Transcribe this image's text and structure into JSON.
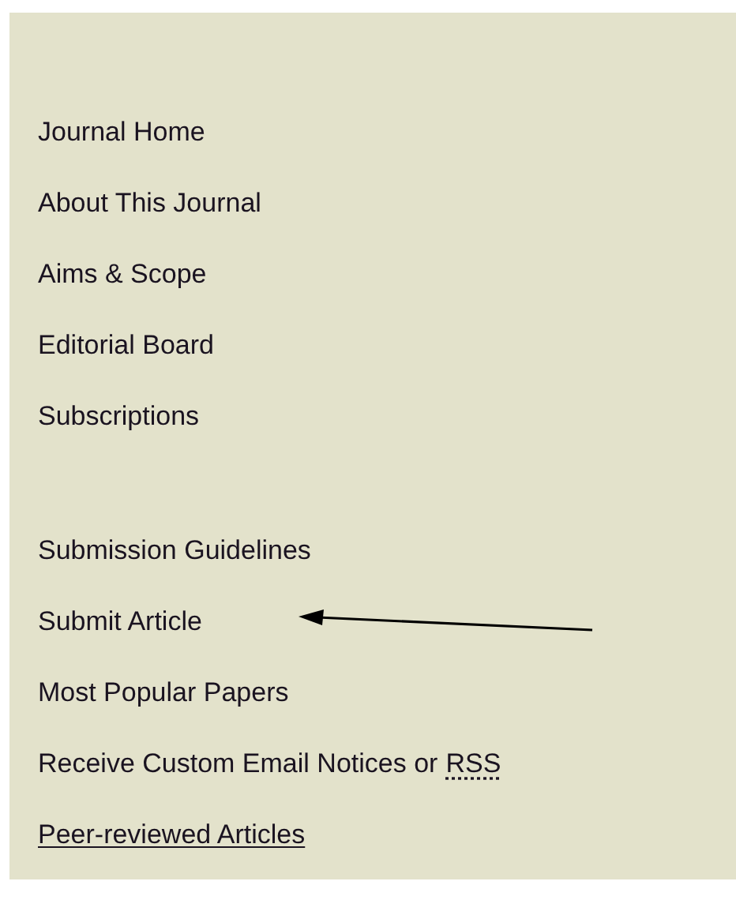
{
  "nav_groups": [
    {
      "items": [
        {
          "label": "Journal Home",
          "underlined": false,
          "arrow": false
        },
        {
          "label": "About This Journal",
          "underlined": false,
          "arrow": false
        },
        {
          "label": "Aims & Scope",
          "underlined": false,
          "arrow": false
        },
        {
          "label": "Editorial Board",
          "underlined": false,
          "arrow": false
        },
        {
          "label": "Subscriptions",
          "underlined": false,
          "arrow": false
        }
      ]
    },
    {
      "items": [
        {
          "label": "Submission Guidelines",
          "underlined": false,
          "arrow": false
        },
        {
          "label": "Submit Article",
          "underlined": false,
          "arrow": true
        },
        {
          "label": "Most Popular Papers",
          "underlined": false,
          "arrow": false
        },
        {
          "label": "Receive Custom Email Notices or",
          "abbr": "RSS",
          "underlined": false,
          "arrow": false
        },
        {
          "label": "Peer-reviewed Articles",
          "underlined": true,
          "arrow": false
        }
      ]
    }
  ]
}
